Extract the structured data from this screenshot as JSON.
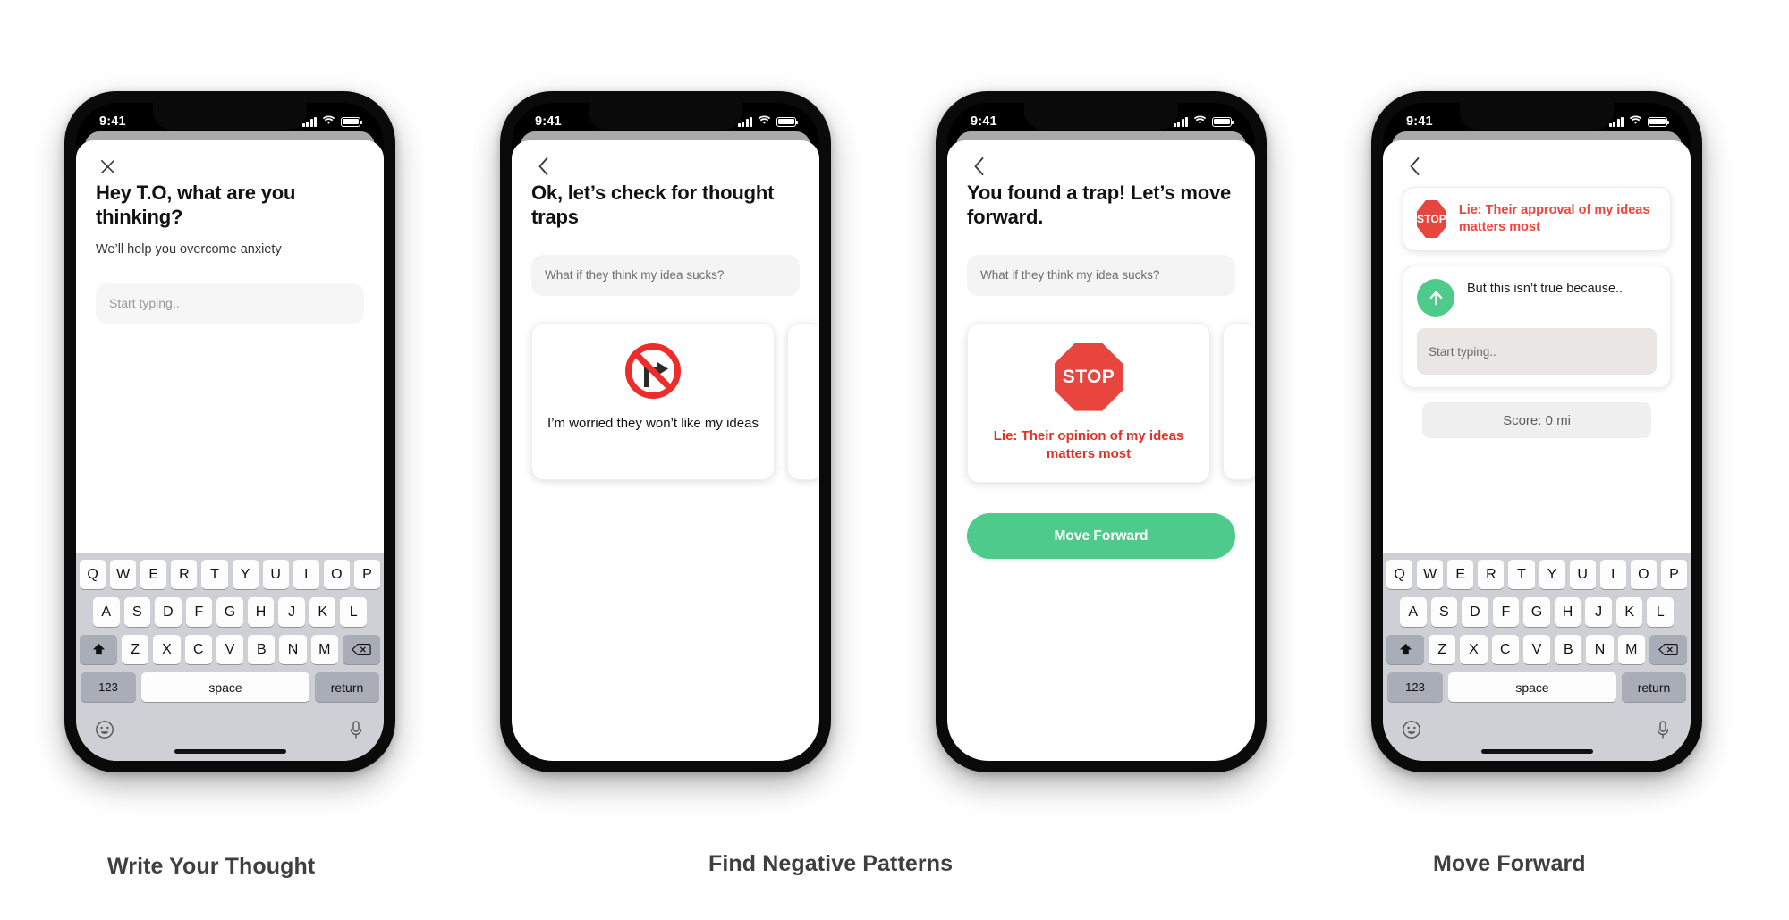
{
  "status_bar": {
    "time": "9:41"
  },
  "keyboard": {
    "row1": [
      "Q",
      "W",
      "E",
      "R",
      "T",
      "Y",
      "U",
      "I",
      "O",
      "P"
    ],
    "row2": [
      "A",
      "S",
      "D",
      "F",
      "G",
      "H",
      "J",
      "K",
      "L"
    ],
    "row3": [
      "Z",
      "X",
      "C",
      "V",
      "B",
      "N",
      "M"
    ],
    "shift_icon": "shift-icon",
    "backspace_icon": "backspace-icon",
    "numbers_key": "123",
    "space_key": "space",
    "return_key": "return",
    "emoji_icon": "emoji-icon",
    "mic_icon": "microphone-icon"
  },
  "screens": [
    {
      "id": "write-thought",
      "nav_icon": "close-icon",
      "headline": "Hey T.O, what are you thinking?",
      "subline": "We’ll help you overcome anxiety",
      "input_placeholder": "Start typing..",
      "caption": "Write Your Thought"
    },
    {
      "id": "find-patterns",
      "nav_icon": "back-chevron-icon",
      "headline": "Ok, let’s check for thought traps",
      "thought": "What if they think my idea sucks?",
      "cards": [
        {
          "icon": "no-right-turn-icon",
          "label": "I’m worried they won’t like my ideas",
          "style": "normal"
        }
      ],
      "caption": "Find Negative Patterns"
    },
    {
      "id": "found-trap",
      "nav_icon": "back-chevron-icon",
      "headline": "You found a trap! Let’s move forward.",
      "thought": "What if they think my idea sucks?",
      "cards": [
        {
          "icon": "stop-sign-icon",
          "icon_text": "STOP",
          "label": "Lie: Their opinion of my ideas matters most",
          "style": "lie"
        }
      ],
      "cta": "Move Forward"
    },
    {
      "id": "move-forward",
      "nav_icon": "back-chevron-icon",
      "rows": [
        {
          "icon": "stop-sign-icon",
          "icon_text": "STOP",
          "text": "Lie: Their approval of my ideas matters most",
          "style": "lie"
        },
        {
          "icon": "up-arrow-circle-icon",
          "text": "But this isn’t true because..",
          "style": "truth",
          "input_placeholder": "Start typing.."
        }
      ],
      "score": "Score: 0 mi",
      "caption": "Move Forward"
    }
  ],
  "colors": {
    "accent_green": "#4ecb8b",
    "alert_red": "#e03127",
    "stop_red": "#e9453f",
    "caption_gray": "#3f3f3f"
  }
}
